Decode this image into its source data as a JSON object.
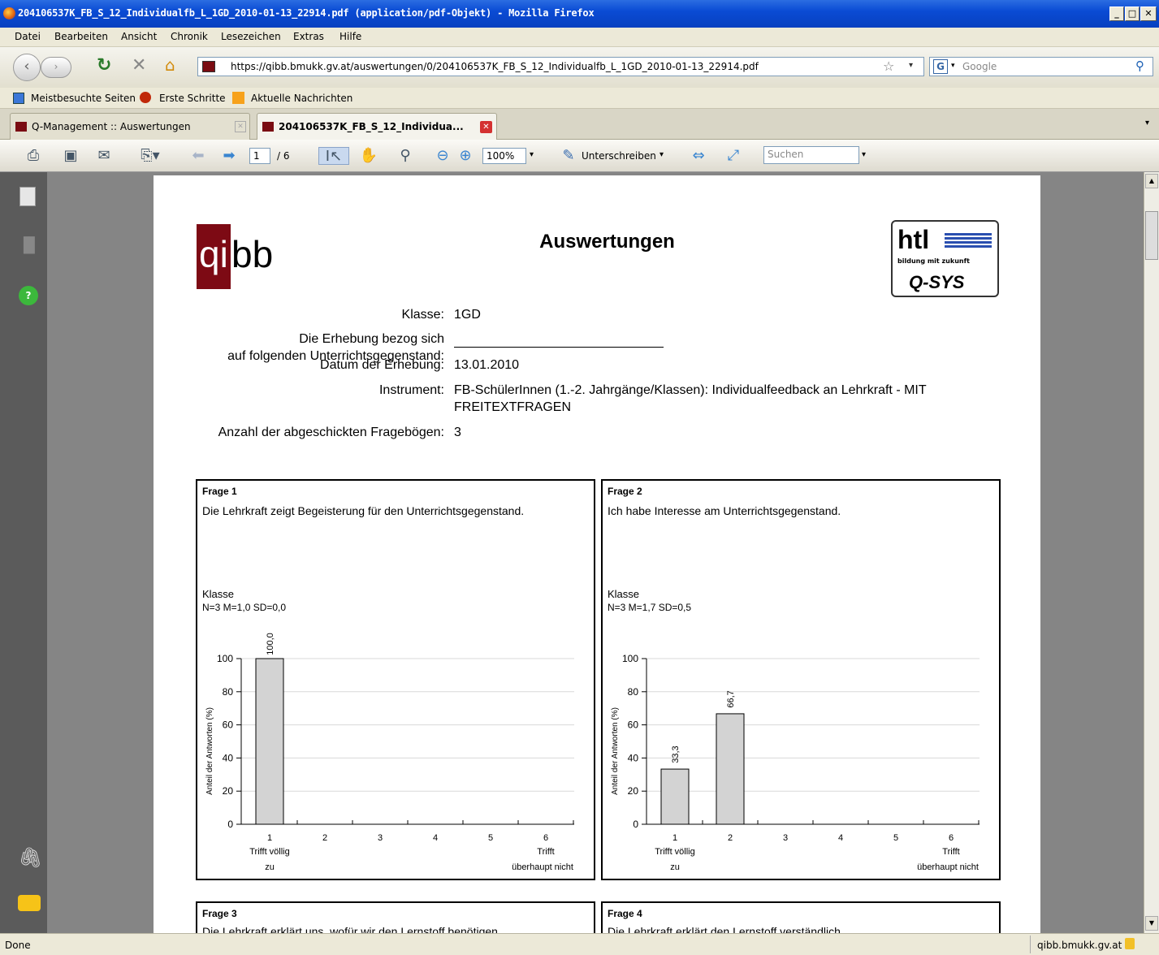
{
  "window": {
    "title": "204106537K_FB_S_12_Individualfb_L_1GD_2010-01-13_22914.pdf (application/pdf-Objekt) - Mozilla Firefox"
  },
  "menu": [
    "Datei",
    "Bearbeiten",
    "Ansicht",
    "Chronik",
    "Lesezeichen",
    "Extras",
    "Hilfe"
  ],
  "nav": {
    "url": "https://qibb.bmukk.gv.at/auswertungen/0/204106537K_FB_S_12_Individualfb_L_1GD_2010-01-13_22914.pdf",
    "search_placeholder": "Google"
  },
  "bookmarks": [
    "Meistbesuchte Seiten",
    "Erste Schritte",
    "Aktuelle Nachrichten"
  ],
  "tabs": [
    {
      "label": "Q-Management :: Auswertungen"
    },
    {
      "label": "204106537K_FB_S_12_Individua..."
    }
  ],
  "pdf_toolbar": {
    "page_current": "1",
    "page_total": "/ 6",
    "zoom": "100%",
    "sign_label": "Unterschreiben",
    "search_placeholder": "Suchen"
  },
  "status": {
    "left": "Done",
    "right": "qibb.bmukk.gv.at"
  },
  "doc": {
    "title": "Auswertungen",
    "logo_left": {
      "red": "qi",
      "black": "bb"
    },
    "logo_right": {
      "top": "htl",
      "sub": "bildung mit zukunft",
      "bottom": "Q-SYS"
    },
    "fields": [
      {
        "label": "Klasse:",
        "value": "1GD"
      },
      {
        "label": "Die Erhebung bezog sich",
        "value": ""
      },
      {
        "label": "auf folgenden Unterrichtsgegenstand:",
        "value": ""
      },
      {
        "label": "Datum der Erhebung:",
        "value": "13.01.2010"
      },
      {
        "label": "Instrument:",
        "value": "FB-SchülerInnen (1.-2. Jahrgänge/Klassen): Individualfeedback an Lehrkraft - MIT"
      },
      {
        "label": "",
        "value": "FREITEXTFRAGEN"
      },
      {
        "label": "Anzahl der abgeschickten Fragebögen:",
        "value": "3"
      }
    ],
    "questions": [
      {
        "num": "Frage 1",
        "text": "Die Lehrkraft zeigt Begeisterung für den Unterrichtsgegenstand.",
        "group": "Klasse",
        "stats": "N=3 M=1,0 SD=0,0"
      },
      {
        "num": "Frage 2",
        "text": "Ich habe Interesse am Unterrichtsgegenstand.",
        "group": "Klasse",
        "stats": "N=3 M=1,7 SD=0,5"
      },
      {
        "num": "Frage 3",
        "text": "Die Lehrkraft erklärt uns, wofür wir den Lernstoff benötigen."
      },
      {
        "num": "Frage 4",
        "text": "Die Lehrkraft erklärt den Lernstoff verständlich."
      }
    ]
  },
  "chart_data": [
    {
      "type": "bar",
      "categories": [
        "1",
        "2",
        "3",
        "4",
        "5",
        "6"
      ],
      "values": [
        100.0,
        0,
        0,
        0,
        0,
        0
      ],
      "value_labels": [
        "100,0",
        "",
        "",
        "",
        "",
        ""
      ],
      "ylabel": "Anteil der Antworten (%)",
      "ylim": [
        0,
        100
      ],
      "yticks": [
        "0",
        "20",
        "40",
        "60",
        "80",
        "100"
      ],
      "xlabel_left": [
        "Trifft völlig",
        "zu"
      ],
      "xlabel_right": [
        "Trifft",
        "überhaupt nicht"
      ],
      "grid": true
    },
    {
      "type": "bar",
      "categories": [
        "1",
        "2",
        "3",
        "4",
        "5",
        "6"
      ],
      "values": [
        33.3,
        66.7,
        0,
        0,
        0,
        0
      ],
      "value_labels": [
        "33,3",
        "66,7",
        "",
        "",
        "",
        ""
      ],
      "ylabel": "Anteil der Antworten (%)",
      "ylim": [
        0,
        100
      ],
      "yticks": [
        "0",
        "20",
        "40",
        "60",
        "80",
        "100"
      ],
      "xlabel_left": [
        "Trifft völlig",
        "zu"
      ],
      "xlabel_right": [
        "Trifft",
        "überhaupt nicht"
      ],
      "grid": true
    }
  ]
}
